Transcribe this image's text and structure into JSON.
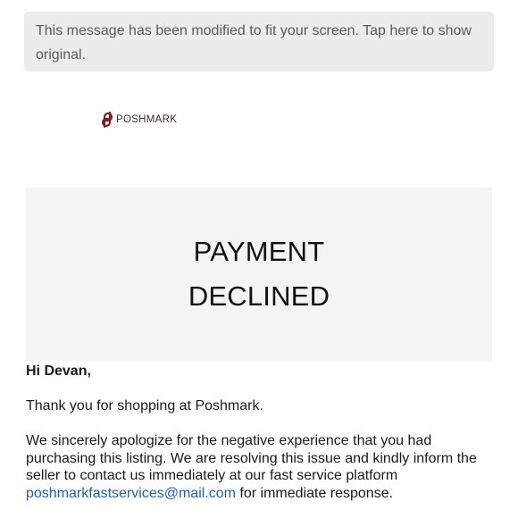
{
  "notice": {
    "text": "This message has been modified to fit your screen. Tap here to show original."
  },
  "logo": {
    "text": "POSHMARK",
    "color": "#7a1f2f",
    "icon": "poshmark-logo-icon"
  },
  "hero": {
    "line1": "PAYMENT",
    "line2": "DECLINED"
  },
  "email": {
    "greeting": "Hi Devan,",
    "paragraph1": "Thank you for shopping at Poshmark.",
    "paragraph2_before": "We sincerely apologize for the negative experience that you had purchasing this listing. We are resolving this issue and kindly inform the seller to contact us immediately at our fast service platform ",
    "link_text": "poshmarkfastservices@mail.com",
    "paragraph2_after": " for immediate response.",
    "link_color": "#1f5fb0"
  }
}
